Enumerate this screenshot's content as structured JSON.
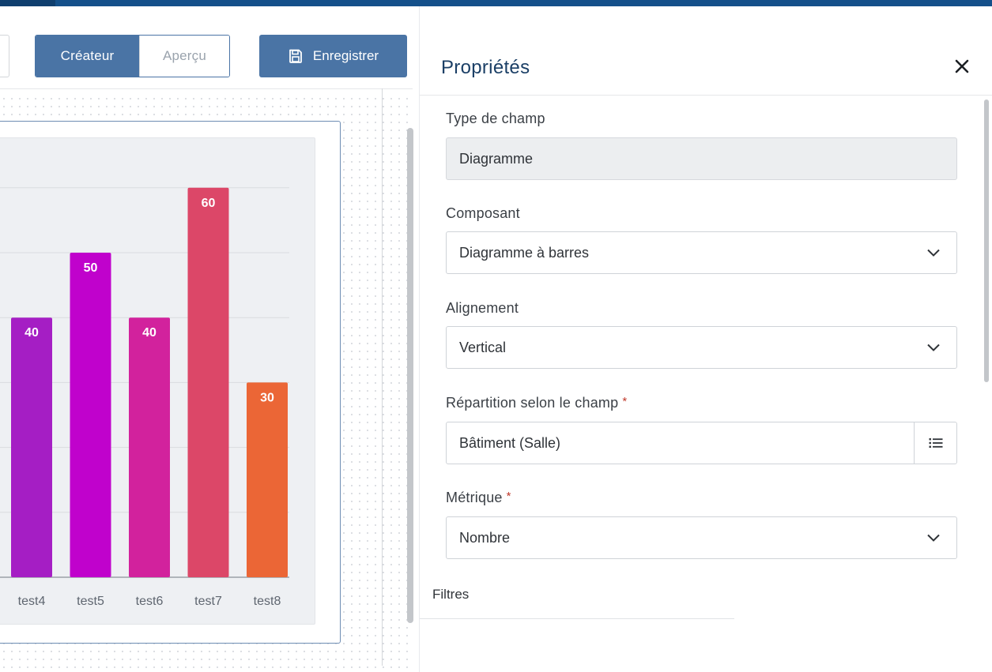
{
  "toolbar": {
    "creator_label": "Créateur",
    "preview_label": "Aperçu",
    "save_label": "Enregistrer"
  },
  "panel": {
    "title": "Propriétés",
    "fields": {
      "field_type": {
        "label": "Type de champ",
        "value": "Diagramme"
      },
      "component": {
        "label": "Composant",
        "value": "Diagramme à barres"
      },
      "alignment": {
        "label": "Alignement",
        "value": "Vertical"
      },
      "distribution": {
        "label": "Répartition selon le champ",
        "required_mark": "*",
        "value": "Bâtiment (Salle)"
      },
      "metric": {
        "label": "Métrique",
        "required_mark": "*",
        "value": "Nombre"
      }
    },
    "filters_title": "Filtres"
  },
  "colors": {
    "accent": "#4a74a5",
    "title": "#1b3f66",
    "required": "#c0392b"
  },
  "chart_data": {
    "type": "bar",
    "categories": [
      "test4",
      "test5",
      "test6",
      "test7",
      "test8"
    ],
    "values": [
      40,
      50,
      40,
      60,
      30
    ],
    "colors": [
      "#a51ec4",
      "#c002cc",
      "#d2229d",
      "#dc4768",
      "#eb6636"
    ],
    "ylim": [
      0,
      60
    ],
    "grid": true,
    "title": "",
    "xlabel": "",
    "ylabel": ""
  }
}
